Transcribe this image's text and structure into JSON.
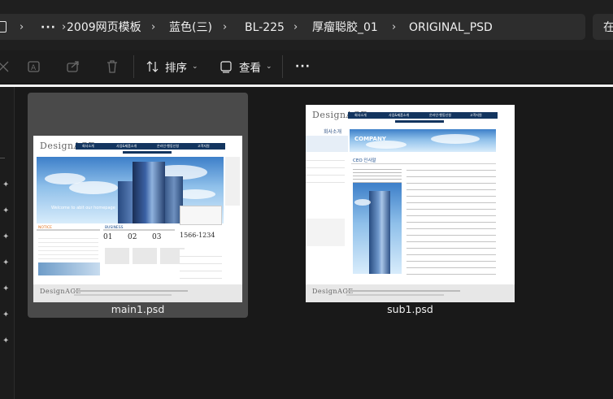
{
  "address_bar": {
    "more": "···",
    "crumbs": [
      "2009网页模板",
      "蓝色(三)",
      "BL-225",
      "厚瘤聪胶_01",
      "ORIGINAL_PSD"
    ],
    "search_partial": "在"
  },
  "toolbar": {
    "sort_label": "排序",
    "view_label": "查看",
    "more_label": "···"
  },
  "files": [
    {
      "name": "main1.psd",
      "selected": true,
      "thumb": {
        "logo": "DesignAGE",
        "nav": [
          "회사소개",
          "사업&제품소개",
          "온라인·행동신청",
          "고객지원"
        ],
        "hero_text": "Welcome to abit our homepage",
        "phone": "1566-1234",
        "nums": [
          "01",
          "02",
          "03"
        ],
        "footer_logo": "DesignAGE"
      }
    },
    {
      "name": "sub1.psd",
      "selected": false,
      "thumb": {
        "logo": "DesignAGE",
        "nav": [
          "회사소개",
          "사업&제품소개",
          "온라인·행동신청",
          "고객지원"
        ],
        "section_title": "회사소개",
        "banner": "COMPANY",
        "heading": "CEO 인사말",
        "footer_logo": "DesignAGE"
      }
    }
  ]
}
